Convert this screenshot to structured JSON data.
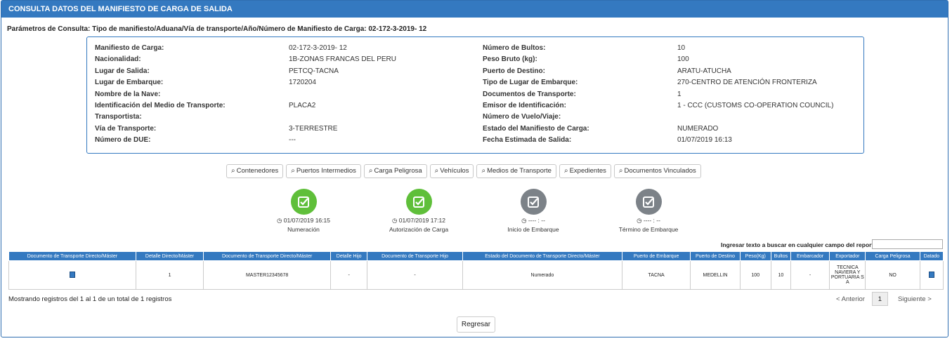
{
  "header": {
    "title": "CONSULTA DATOS DEL MANIFIESTO DE CARGA DE SALIDA"
  },
  "params": {
    "label": "Parámetros de Consulta:",
    "value": "Tipo de manifiesto/Aduana/Vía de transporte/Año/Número de Manifiesto de Carga: 02-172-3-2019- 12"
  },
  "info": {
    "left": [
      {
        "label": "Manifiesto de Carga:",
        "value": "02-172-3-2019- 12"
      },
      {
        "label": "Nacionalidad:",
        "value": "1B-ZONAS FRANCAS DEL PERU"
      },
      {
        "label": "Lugar de Salida:",
        "value": "PETCQ-TACNA"
      },
      {
        "label": "Lugar de Embarque:",
        "value": "1720204"
      },
      {
        "label": "Nombre de la Nave:",
        "value": ""
      },
      {
        "label": "Identificación del Medio de Transporte:",
        "value": "PLACA2"
      },
      {
        "label": "Transportista:",
        "value": ""
      },
      {
        "label": "Vía de Transporte:",
        "value": "3-TERRESTRE"
      },
      {
        "label": "Número de DUE:",
        "value": "---"
      }
    ],
    "right": [
      {
        "label": "Número de Bultos:",
        "value": "10"
      },
      {
        "label": "Peso Bruto (kg):",
        "value": "100"
      },
      {
        "label": "Puerto de Destino:",
        "value": "ARATU-ATUCHA"
      },
      {
        "label": "Tipo de Lugar de Embarque:",
        "value": "270-CENTRO DE ATENCIÓN FRONTERIZA"
      },
      {
        "label": "Documentos de Transporte:",
        "value": "1"
      },
      {
        "label": "Emisor de Identificación:",
        "value": "1 - CCC (CUSTOMS CO-OPERATION COUNCIL)"
      },
      {
        "label": "Número de Vuelo/Viaje:",
        "value": ""
      },
      {
        "label": "Estado del Manifiesto de Carga:",
        "value": "NUMERADO"
      },
      {
        "label": "Fecha Estimada de Salida:",
        "value": "01/07/2019 16:13"
      }
    ]
  },
  "buttons": [
    {
      "label": "Contenedores",
      "icon": "search-icon"
    },
    {
      "label": "Puertos Intermedios",
      "icon": "search-icon"
    },
    {
      "label": "Carga Peligrosa",
      "icon": "search-icon"
    },
    {
      "label": "Vehículos",
      "icon": "search-icon"
    },
    {
      "label": "Medios de Transporte",
      "icon": "search-icon"
    },
    {
      "label": "Expedientes",
      "icon": "search-icon"
    },
    {
      "label": "Documentos Vinculados",
      "icon": "search-icon"
    }
  ],
  "steps": [
    {
      "time": "01/07/2019 16:15",
      "label": "Numeración",
      "status": "done",
      "color": "#5fbf3a"
    },
    {
      "time": "01/07/2019 17:12",
      "label": "Autorización de Carga",
      "status": "done",
      "color": "#5fbf3a"
    },
    {
      "time": "---- : --",
      "label": "Inicio de Embarque",
      "status": "pending",
      "color": "#7c8288"
    },
    {
      "time": "---- : --",
      "label": "Término de Embarque",
      "status": "pending",
      "color": "#7c8288"
    }
  ],
  "search": {
    "label": "Ingresar texto a buscar en cualquier campo del reporte:",
    "value": ""
  },
  "table": {
    "headers": [
      "Documento de Transporte Directo/Máster",
      "Detalle Directo/Máster",
      "Documento de Transporte Directo/Máster",
      "Detalle Hijo",
      "Documento de Transporte Hijo",
      "Estado del Documento de Transporte Directo/Máster",
      "Puerto de Embarque",
      "Puerto de Destino",
      "Peso(Kg)",
      "Bultos",
      "Embarcador",
      "Exportador",
      "Carga Peligrosa",
      "Datado"
    ],
    "rows": [
      [
        "",
        "1",
        "MASTER12345678",
        "-",
        "-",
        "Numerado",
        "TACNA",
        "MEDELLIN",
        "100",
        "10",
        "-",
        "TECNICA NAVIERA Y PORTUARIA S A",
        "NO",
        ""
      ]
    ]
  },
  "summary": "Mostrando registros del 1 al 1 de un total de 1 registros",
  "pager": {
    "prev": "< Anterior",
    "page": "1",
    "next": "Siguiente >"
  },
  "back_button": "Regresar"
}
